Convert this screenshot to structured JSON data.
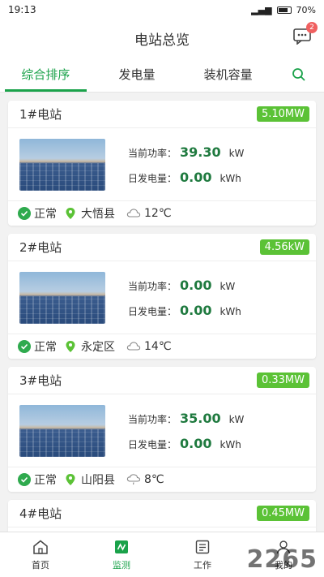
{
  "status": {
    "time": "19:13",
    "battery": "70%"
  },
  "header": {
    "title": "电站总览",
    "message_badge": "2"
  },
  "tabs": [
    {
      "label": "综合排序",
      "active": true
    },
    {
      "label": "发电量",
      "active": false
    },
    {
      "label": "装机容量",
      "active": false
    },
    {
      "label": "",
      "icon": "search-icon"
    }
  ],
  "stations": [
    {
      "name": "1#电站",
      "capacity": "5.10MW",
      "power_label": "当前功率：",
      "power": "39.30",
      "power_unit": "kW",
      "daily_label": "日发电量：",
      "daily": "0.00",
      "daily_unit": "kWh",
      "status": "正常",
      "location": "大悟县",
      "weather": "12℃"
    },
    {
      "name": "2#电站",
      "capacity": "4.56kW",
      "power_label": "当前功率：",
      "power": "0.00",
      "power_unit": "kW",
      "daily_label": "日发电量：",
      "daily": "0.00",
      "daily_unit": "kWh",
      "status": "正常",
      "location": "永定区",
      "weather": "14℃"
    },
    {
      "name": "3#电站",
      "capacity": "0.33MW",
      "power_label": "当前功率：",
      "power": "35.00",
      "power_unit": "kW",
      "daily_label": "日发电量：",
      "daily": "0.00",
      "daily_unit": "kWh",
      "status": "正常",
      "location": "山阳县",
      "weather": "8℃"
    },
    {
      "name": "4#电站",
      "capacity": "0.45MW"
    }
  ],
  "nav": [
    {
      "label": "首页",
      "icon": "home-icon",
      "active": false
    },
    {
      "label": "监测",
      "icon": "monitor-icon",
      "active": true
    },
    {
      "label": "工作",
      "icon": "work-icon",
      "active": false
    },
    {
      "label": "我的",
      "icon": "profile-icon",
      "active": false
    }
  ],
  "watermark": "2265",
  "colors": {
    "accent": "#1aa24a",
    "capacity_badge": "#5bc236",
    "value": "#1f7a3f"
  }
}
